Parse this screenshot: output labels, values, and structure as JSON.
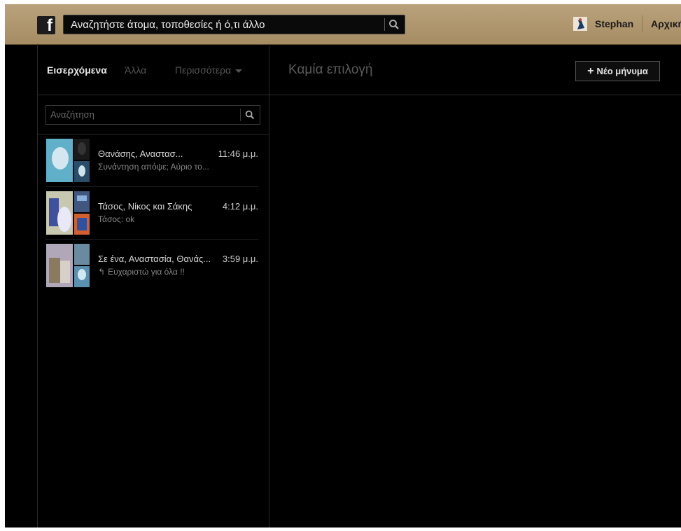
{
  "topbar": {
    "search_placeholder": "Αναζητήστε άτομα, τοποθεσίες ή ό,τι άλλο",
    "user_name": "Stephan",
    "home_label": "Αρχική"
  },
  "header": {
    "inbox_tab": "Εισερχόμενα",
    "other_tab": "Άλλα",
    "more_tab": "Περισσότερα",
    "no_selection": "Καμία επιλογή",
    "new_message_label": "Νέο μήνυμα"
  },
  "message_search": {
    "placeholder": "Αναζήτηση"
  },
  "threads": [
    {
      "names": "Θανάσης, Αναστασ...",
      "time": "11:46 μ.μ.",
      "snippet": "Συνάντηση απόψε; Αύριο το..."
    },
    {
      "names": "Τάσος, Νίκος και Σάκης",
      "time": "4:12 μ.μ.",
      "snippet": "Τάσος: ok"
    },
    {
      "names": "Σε ένα, Αναστασία, Θανάς...",
      "time": "3:59 μ.μ.",
      "snippet": "Ευχαριστώ για όλα !!"
    }
  ],
  "colors": {
    "topbar": "#b9a27c",
    "background": "#000000"
  }
}
